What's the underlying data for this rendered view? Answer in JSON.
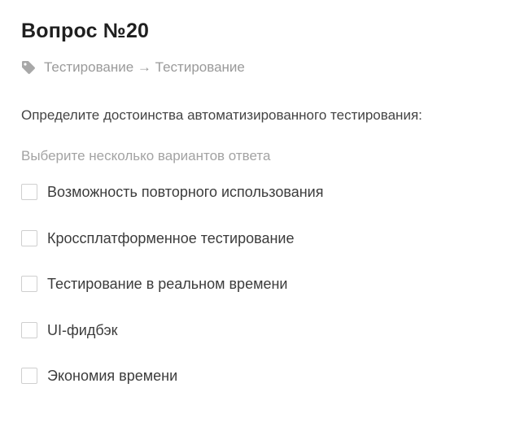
{
  "question": {
    "title": "Вопрос №20",
    "tag_icon": "tag-icon",
    "breadcrumb": "Тестирование → Тестирование",
    "text": "Определите достоинства автоматизированного тестирования:",
    "hint": "Выберите несколько вариантов ответа",
    "options": [
      {
        "label": "Возможность повторного использования",
        "checked": false
      },
      {
        "label": "Кроссплатформенное тестирование",
        "checked": false
      },
      {
        "label": "Тестирование в реальном времени",
        "checked": false
      },
      {
        "label": "UI-фидбэк",
        "checked": false
      },
      {
        "label": "Экономия времени",
        "checked": false
      }
    ]
  },
  "colors": {
    "title": "#1f1f1f",
    "muted": "#9a9a9a",
    "checkbox_border": "#cfcfcf"
  }
}
